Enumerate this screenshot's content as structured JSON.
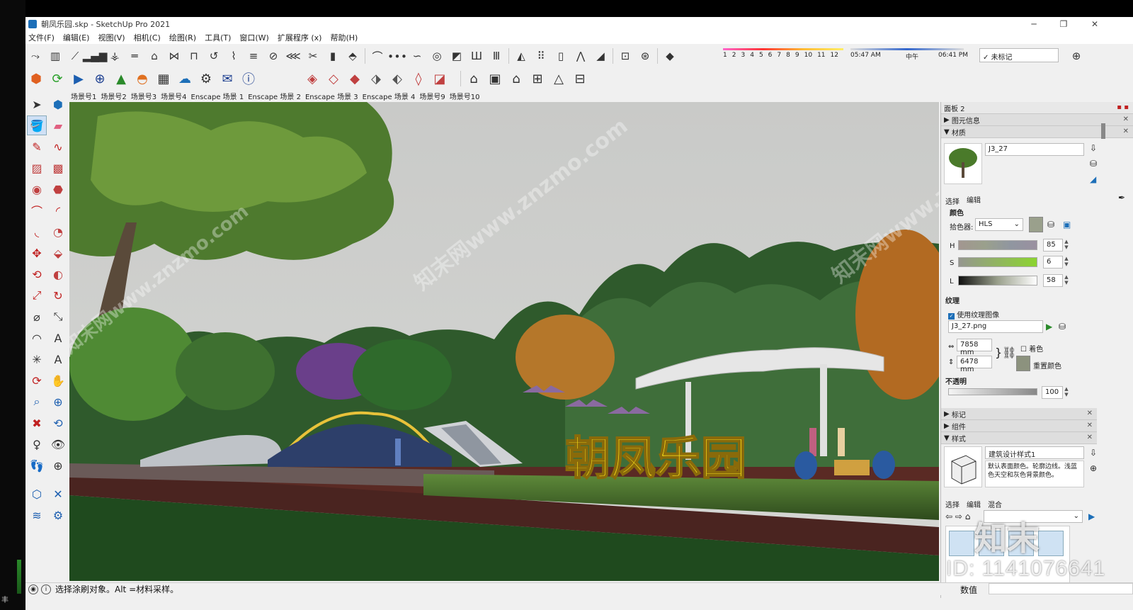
{
  "window": {
    "title": "朝凤乐园.skp - SketchUp Pro 2021"
  },
  "menu": [
    "文件(F)",
    "编辑(E)",
    "视图(V)",
    "相机(C)",
    "绘图(R)",
    "工具(T)",
    "窗口(W)",
    "扩展程序 (x)",
    "帮助(H)"
  ],
  "shadow": {
    "months": [
      "1",
      "2",
      "3",
      "4",
      "5",
      "6",
      "7",
      "8",
      "9",
      "10",
      "11",
      "12"
    ],
    "time_start": "05:47 AM",
    "time_mid": "中午",
    "time_end": "06:41 PM"
  },
  "tag_select": "✓ 未标记",
  "scenes": [
    "场景号1",
    "场景号2",
    "场景号3",
    "场景号4",
    "Enscape 场景 1",
    "Enscape 场景 2",
    "Enscape 场景 3",
    "Enscape 场景 4",
    "场景号9",
    "场景号10"
  ],
  "viewport": {
    "sign_text": "朝凤乐园",
    "watermark": "知末网www.znzmo.com"
  },
  "panel": {
    "title": "面板 2",
    "entity_info": "图元信息",
    "materials": "材质",
    "material_name": "J3_27",
    "tab_select": "选择",
    "tab_edit": "编辑",
    "color_section": "颜色",
    "picker_label": "拾色器:",
    "picker_value": "HLS",
    "h_label": "H",
    "h_value": "85",
    "s_label": "S",
    "s_value": "6",
    "l_label": "L",
    "l_value": "58",
    "texture_section": "纹理",
    "use_texture": "使用纹理图像",
    "texture_file": "J3_27.png",
    "width": "7858 mm",
    "height": "6478 mm",
    "colorize": "着色",
    "reset_color": "重置颜色",
    "opacity_section": "不透明",
    "opacity_value": "100",
    "tags": "标记",
    "components": "组件",
    "styles": "样式",
    "style_name": "建筑设计样式1",
    "style_desc": "默认表面颜色。轮廓边线。浅蓝色天空和灰色背景颜色。",
    "style_tab_select": "选择",
    "style_tab_edit": "编辑",
    "style_tab_mix": "混合"
  },
  "status": {
    "text": "选择涂刷对象。Alt =材料采样。",
    "measure_label": "数值"
  },
  "watermarks": {
    "id": "ID: 1141076641",
    "brand": "知末"
  },
  "colors": {
    "accent": "#1d6fb8",
    "sign_yellow": "#f2d81a"
  }
}
